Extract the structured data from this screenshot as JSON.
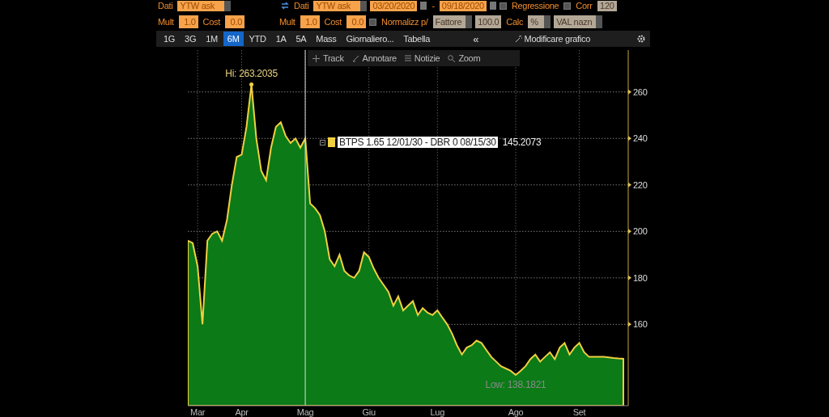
{
  "controls": {
    "series_a": {
      "row_1": [
        {
          "kind": "label",
          "text": "Dati"
        },
        {
          "kind": "select",
          "value": "YTW ask"
        }
      ],
      "row_2": [
        {
          "kind": "label",
          "text": "Mult"
        },
        {
          "kind": "input",
          "value": "1.0"
        },
        {
          "kind": "label",
          "text": "Cost"
        },
        {
          "kind": "input",
          "value": "0.0"
        }
      ]
    },
    "series_b": {
      "row_1": [
        {
          "kind": "swap"
        },
        {
          "kind": "label",
          "text": "Dati"
        },
        {
          "kind": "select",
          "value": "YTW ask"
        },
        {
          "kind": "date",
          "value": "03/20/2020"
        },
        {
          "kind": "label",
          "text": "-"
        },
        {
          "kind": "date",
          "value": "09/18/2020"
        },
        {
          "kind": "checkbox",
          "text": "Regressione",
          "checked": false
        },
        {
          "kind": "checkbox",
          "text": "Corr",
          "checked": false
        },
        {
          "kind": "grey_input",
          "value": "120"
        }
      ],
      "row_2": [
        {
          "kind": "label",
          "text": "Mult"
        },
        {
          "kind": "input",
          "value": "1.0"
        },
        {
          "kind": "label",
          "text": "Cost"
        },
        {
          "kind": "input",
          "value": "0.0"
        },
        {
          "kind": "checkbox",
          "text": "Normalizz p/",
          "checked": false
        },
        {
          "kind": "grey_select",
          "value": "Fattore"
        },
        {
          "kind": "grey_input",
          "value": "100.0"
        },
        {
          "kind": "label",
          "text": "Calc"
        },
        {
          "kind": "grey_select",
          "value": "%"
        },
        {
          "kind": "grey_select",
          "value": "VAL nazn"
        }
      ]
    }
  },
  "period_tabs": [
    {
      "label": "1G",
      "selected": false
    },
    {
      "label": "3G",
      "selected": false
    },
    {
      "label": "1M",
      "selected": false
    },
    {
      "label": "6M",
      "selected": true
    },
    {
      "label": "YTD",
      "selected": false
    },
    {
      "label": "1A",
      "selected": false
    },
    {
      "label": "5A",
      "selected": false
    },
    {
      "label": "Mass",
      "selected": false
    },
    {
      "label": "Giornaliero...",
      "selected": false
    },
    {
      "label": "Tabella",
      "selected": false
    }
  ],
  "collapse_button": "«",
  "edit_chart_button": "Modificare grafico",
  "chart_toolbar": [
    {
      "kind": "track",
      "label": "Track"
    },
    {
      "kind": "annotate",
      "label": "Annotare"
    },
    {
      "kind": "news",
      "label": "Notizie"
    },
    {
      "kind": "zoom",
      "label": "Zoom"
    }
  ],
  "chart": {
    "legend": {
      "value": "145.2073"
    },
    "chart_data": {
      "type": "area",
      "grid": true,
      "ylim": [
        125,
        278
      ],
      "categories": [
        null,
        null,
        "Mar",
        null,
        null,
        null,
        null,
        null,
        null,
        null,
        null,
        "Apr",
        null,
        null,
        null,
        null,
        null,
        null,
        null,
        null,
        null,
        null,
        null,
        null,
        "Mag",
        null,
        null,
        null,
        null,
        null,
        null,
        null,
        null,
        null,
        null,
        null,
        null,
        "Giu",
        null,
        null,
        null,
        null,
        null,
        null,
        null,
        null,
        null,
        null,
        null,
        null,
        null,
        "Lug",
        null,
        null,
        null,
        null,
        null,
        null,
        null,
        null,
        null,
        null,
        null,
        null,
        null,
        null,
        null,
        "Ago",
        null,
        null,
        null,
        null,
        null,
        null,
        null,
        null,
        null,
        null,
        null,
        null,
        "Set",
        null,
        null,
        null,
        null,
        null,
        null,
        null,
        null,
        null
      ],
      "yticks": [
        160,
        180,
        200,
        220,
        240,
        260
      ],
      "series": [
        {
          "name": "BTPS 1.65 12/01/30 - DBR 0 08/15/30",
          "color": "#f0d040",
          "values": [
            196,
            195,
            185,
            160,
            196,
            199,
            200,
            196,
            205,
            220,
            232,
            233,
            245,
            263.2,
            240,
            226,
            222,
            236,
            245,
            247,
            241,
            238,
            240,
            236,
            240,
            212,
            210,
            207,
            200,
            188,
            185,
            190,
            183,
            181,
            180,
            183,
            191,
            189,
            184,
            180,
            177,
            174,
            168,
            172,
            166,
            168,
            170,
            164,
            167,
            165,
            164,
            166,
            163,
            160,
            156,
            151,
            147,
            150,
            151,
            153,
            152,
            149,
            146,
            144,
            142,
            141,
            140,
            138.2,
            140,
            142,
            145,
            147,
            144,
            146,
            148,
            145,
            150,
            152,
            147,
            150,
            152,
            148,
            146,
            146,
            146,
            146,
            145.8,
            145.5,
            145.3,
            145.2
          ]
        }
      ],
      "ref_lines": [
        {
          "axis": "x",
          "value": "Mag"
        }
      ],
      "annotations": [
        {
          "y": 263.2,
          "text": "Hi: 263.2035"
        },
        {
          "y": 138.2,
          "text": "Low: 138.1821"
        }
      ]
    }
  }
}
